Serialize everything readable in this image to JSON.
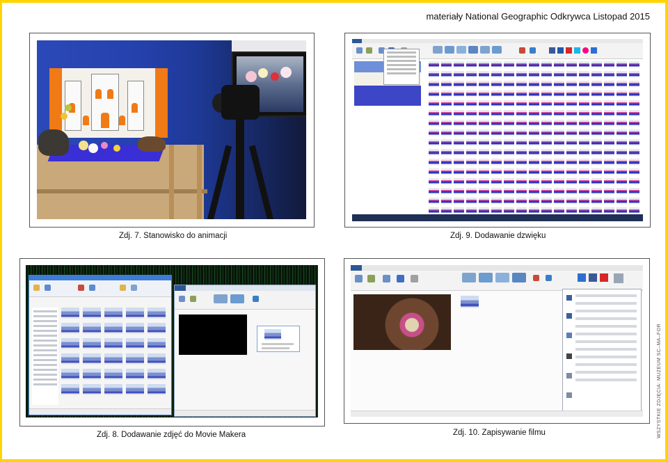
{
  "header": {
    "title": "materiały National Geographic Odkrywca Listopad 2015"
  },
  "credit": {
    "text": "WSZYSTKIE ZDJĘCIA: MUZEUM SC–MA–FOR"
  },
  "photos": [
    {
      "id": "7",
      "caption": "Zdj. 7. Stanowisko do animacji"
    },
    {
      "id": "9",
      "caption": "Zdj. 9. Dodawanie dzwięku"
    },
    {
      "id": "8",
      "caption": "Zdj. 8. Dodawanie zdjęć do  Movie Makera"
    },
    {
      "id": "10",
      "caption": "Zdj. 10. Zapisywanie filmu"
    }
  ],
  "colors": {
    "page_border": "#ffd400",
    "frame": "#555555"
  },
  "icons": [
    "castle-set-image",
    "camera-on-tripod-image",
    "movie-maker-window-icon",
    "explorer-window-icon"
  ]
}
